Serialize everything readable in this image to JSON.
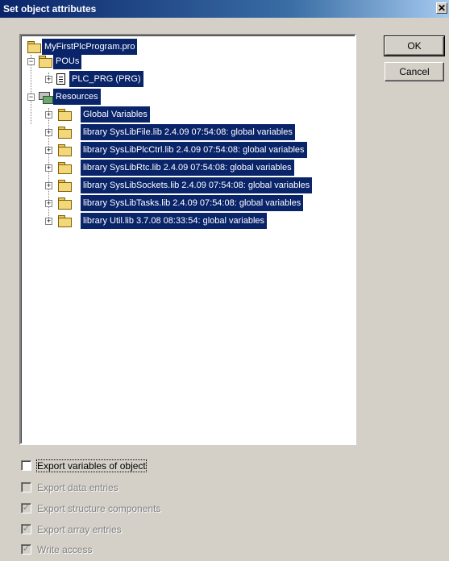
{
  "window": {
    "title": "Set object attributes",
    "close_glyph": "✕"
  },
  "buttons": {
    "ok": "OK",
    "cancel": "Cancel"
  },
  "tree": {
    "root": "MyFirstPlcProgram.pro",
    "pous": "POUs",
    "plc_prg": "PLC_PRG (PRG)",
    "resources": "Resources",
    "resource_items": [
      "Global Variables",
      "library SysLibFile.lib 2.4.09 07:54:08: global variables",
      "library SysLibPlcCtrl.lib 2.4.09 07:54:08: global variables",
      "library SysLibRtc.lib 2.4.09 07:54:08: global variables",
      "library SysLibSockets.lib 2.4.09 07:54:08: global variables",
      "library SysLibTasks.lib 2.4.09 07:54:08: global variables",
      "library Util.lib 3.7.08 08:33:54: global variables"
    ]
  },
  "options": [
    {
      "label": "Export variables of object",
      "checked": false,
      "enabled": true
    },
    {
      "label": "Export data entries",
      "checked": false,
      "enabled": false
    },
    {
      "label": "Export structure components",
      "checked": true,
      "enabled": false
    },
    {
      "label": "Export array entries",
      "checked": true,
      "enabled": false
    },
    {
      "label": "Write access",
      "checked": true,
      "enabled": false
    }
  ],
  "colors": {
    "selection": "#0a246a",
    "dialog_bg": "#d4d0c8"
  }
}
